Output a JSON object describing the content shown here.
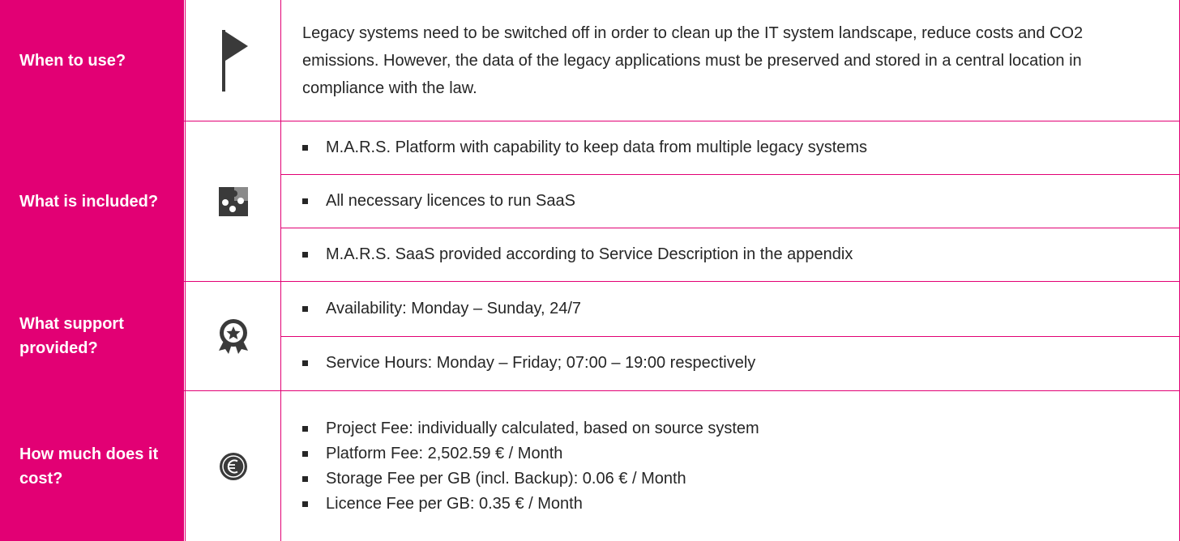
{
  "rows": {
    "when": {
      "label": "When to use?",
      "icon": "flag-icon",
      "text": "Legacy systems need to be switched off in order to clean up the IT system landscape, reduce costs and CO2 emissions. However, the data of the legacy applications must be preserved and stored in a central location in compliance with the law."
    },
    "included": {
      "label": "What is included?",
      "icon": "puzzle-icon",
      "items": [
        "M.A.R.S. Platform with capability to keep data from multiple legacy systems",
        "All necessary licences to run SaaS",
        "M.A.R.S. SaaS provided according to Service Description in the appendix"
      ]
    },
    "support": {
      "label": "What support provided?",
      "icon": "award-medal-icon",
      "items": [
        "Availability: Monday – Sunday, 24/7",
        "Service Hours: Monday – Friday; 07:00 – 19:00 respectively"
      ]
    },
    "cost": {
      "label": "How much does it cost?",
      "icon": "euro-coin-icon",
      "items": [
        "Project Fee: individually calculated, based on source system",
        "Platform Fee: 2,502.59 € / Month",
        "Storage Fee per GB (incl. Backup): 0.06 € / Month",
        "Licence Fee per GB: 0.35 € / Month"
      ]
    }
  },
  "colors": {
    "accent": "#e20074",
    "text": "#262626",
    "icon": "#3a3a3a"
  }
}
